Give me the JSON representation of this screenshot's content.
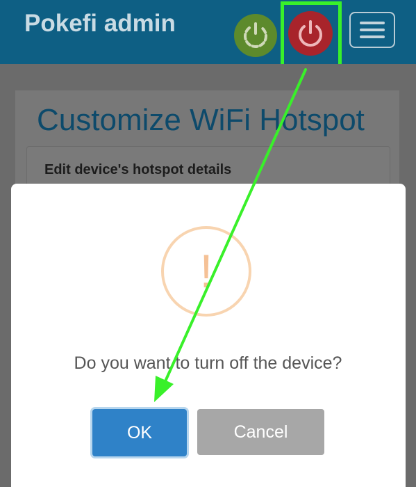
{
  "header": {
    "title": "Pokefi admin",
    "reboot_icon": "refresh-power-icon",
    "power_icon": "power-icon",
    "menu_icon": "hamburger-menu-icon"
  },
  "page": {
    "title": "Customize WiFi Hotspot",
    "card_header": "Edit device's hotspot details"
  },
  "dialog": {
    "icon": "warning-icon",
    "icon_glyph": "!",
    "message": "Do you want to turn off the device?",
    "ok_label": "OK",
    "cancel_label": "Cancel"
  },
  "colors": {
    "header_bg": "#0e5f84",
    "power_button": "#a8242b",
    "reboot_button": "#5d8a2c",
    "ok_button": "#2f82c8",
    "cancel_button": "#a7a7a7",
    "annotation": "#39f02a"
  }
}
